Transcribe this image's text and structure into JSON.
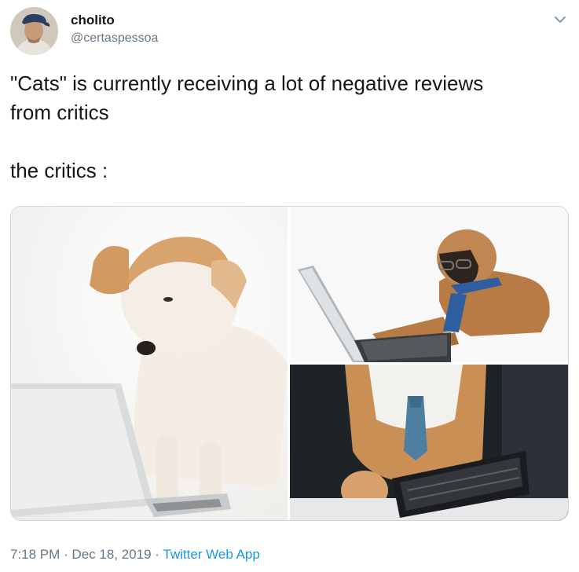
{
  "user": {
    "name": "cholito",
    "handle": "@certaspessoa"
  },
  "tweet": {
    "lines": [
      "\"Cats\" is currently receiving a lot of negative reviews",
      "from critics",
      "the critics :"
    ]
  },
  "media": {
    "photos": [
      {
        "label": "dog-looking-at-laptop"
      },
      {
        "label": "boxer-dog-with-glasses-and-tie-using-laptop"
      },
      {
        "label": "dog-with-tie-at-keyboard"
      }
    ]
  },
  "meta": {
    "time": "7:18 PM",
    "separator": " · ",
    "date": "Dec 18, 2019",
    "source": "Twitter Web App"
  },
  "icons": {
    "caret": "chevron-down-icon"
  },
  "colors": {
    "link": "#1b95e0",
    "secondary_text": "#657786",
    "border": "#ccd6dd"
  }
}
